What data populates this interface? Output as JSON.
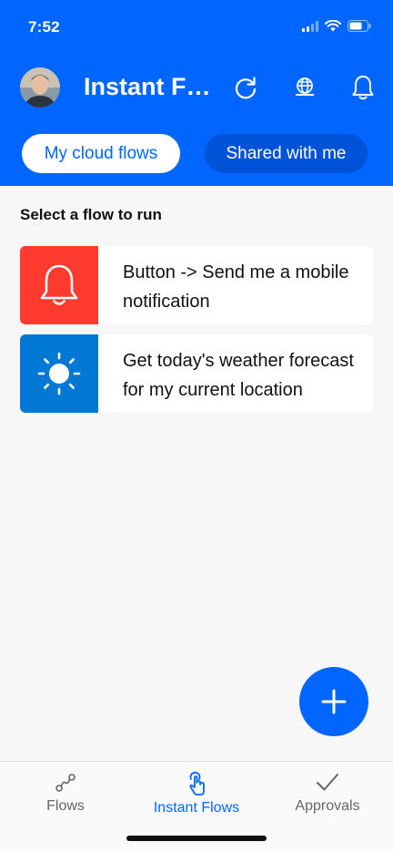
{
  "status_bar": {
    "time": "7:52"
  },
  "header": {
    "title": "Instant Flows",
    "icons": [
      "refresh-icon",
      "globe-icon",
      "bell-icon"
    ],
    "background": "#0066ff"
  },
  "tabs": [
    {
      "label": "My cloud flows",
      "selected": true
    },
    {
      "label": "Shared with me",
      "selected": false
    }
  ],
  "section_title": "Select a flow to run",
  "flows": [
    {
      "label": "Button -> Send me a mobile notification",
      "icon": "bell-icon",
      "color": "#ff3b30"
    },
    {
      "label": "Get today's weather forecast for my current location",
      "icon": "sun-icon",
      "color": "#0078d4"
    }
  ],
  "fab": {
    "icon": "plus-icon"
  },
  "bottom_nav": [
    {
      "label": "Flows",
      "icon": "flows-icon",
      "selected": false
    },
    {
      "label": "Instant Flows",
      "icon": "touch-icon",
      "selected": true
    },
    {
      "label": "Approvals",
      "icon": "checkmark-icon",
      "selected": false
    }
  ],
  "accent": "#0066ff"
}
